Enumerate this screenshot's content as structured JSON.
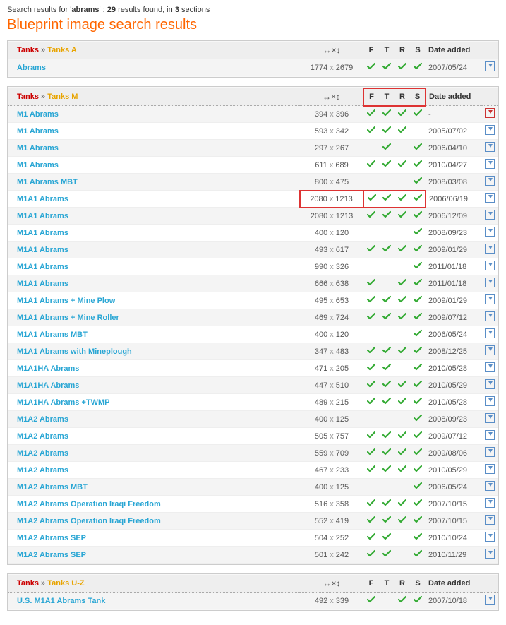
{
  "summary_prefix": "Search results for '",
  "query": "abrams",
  "summary_mid": "' : ",
  "result_count": "29",
  "summary_mid2": " results found, in ",
  "section_count": "3",
  "summary_suffix": " sections",
  "page_title": "Blueprint image search results",
  "col_labels": {
    "F": "F",
    "T": "T",
    "R": "R",
    "S": "S",
    "date": "Date added"
  },
  "dim_glyph": "↔×↕",
  "sections": [
    {
      "crumb_root": "Tanks",
      "crumb_leaf": "Tanks A",
      "rows": [
        {
          "name": "Abrams",
          "w": "1774",
          "h": "2679",
          "f": true,
          "t": true,
          "r": true,
          "s": true,
          "date": "2007/05/24",
          "dl": "blue"
        }
      ]
    },
    {
      "crumb_root": "Tanks",
      "crumb_leaf": "Tanks M",
      "highlight_ftrs_header": true,
      "rows": [
        {
          "name": "M1 Abrams",
          "w": "394",
          "h": "396",
          "f": true,
          "t": true,
          "r": true,
          "s": true,
          "date": "-",
          "dl": "red"
        },
        {
          "name": "M1 Abrams",
          "w": "593",
          "h": "342",
          "f": true,
          "t": true,
          "r": true,
          "s": false,
          "date": "2005/07/02",
          "dl": "blue"
        },
        {
          "name": "M1 Abrams",
          "w": "297",
          "h": "267",
          "f": false,
          "t": true,
          "r": false,
          "s": true,
          "date": "2006/04/10",
          "dl": "blue"
        },
        {
          "name": "M1 Abrams",
          "w": "611",
          "h": "689",
          "f": true,
          "t": true,
          "r": true,
          "s": true,
          "date": "2010/04/27",
          "dl": "blue"
        },
        {
          "name": "M1 Abrams MBT",
          "w": "800",
          "h": "475",
          "f": false,
          "t": false,
          "r": false,
          "s": true,
          "date": "2008/03/08",
          "dl": "blue"
        },
        {
          "name": "M1A1 Abrams",
          "w": "2080",
          "h": "1213",
          "f": true,
          "t": true,
          "r": true,
          "s": true,
          "date": "2006/06/19",
          "dl": "blue",
          "highlight": true
        },
        {
          "name": "M1A1 Abrams",
          "w": "2080",
          "h": "1213",
          "f": true,
          "t": true,
          "r": true,
          "s": true,
          "date": "2006/12/09",
          "dl": "blue"
        },
        {
          "name": "M1A1 Abrams",
          "w": "400",
          "h": "120",
          "f": false,
          "t": false,
          "r": false,
          "s": true,
          "date": "2008/09/23",
          "dl": "blue"
        },
        {
          "name": "M1A1 Abrams",
          "w": "493",
          "h": "617",
          "f": true,
          "t": true,
          "r": true,
          "s": true,
          "date": "2009/01/29",
          "dl": "blue"
        },
        {
          "name": "M1A1 Abrams",
          "w": "990",
          "h": "326",
          "f": false,
          "t": false,
          "r": false,
          "s": true,
          "date": "2011/01/18",
          "dl": "blue"
        },
        {
          "name": "M1A1 Abrams",
          "w": "666",
          "h": "638",
          "f": true,
          "t": false,
          "r": true,
          "s": true,
          "date": "2011/01/18",
          "dl": "blue"
        },
        {
          "name": "M1A1 Abrams + Mine Plow",
          "w": "495",
          "h": "653",
          "f": true,
          "t": true,
          "r": true,
          "s": true,
          "date": "2009/01/29",
          "dl": "blue"
        },
        {
          "name": "M1A1 Abrams + Mine Roller",
          "w": "469",
          "h": "724",
          "f": true,
          "t": true,
          "r": true,
          "s": true,
          "date": "2009/07/12",
          "dl": "blue"
        },
        {
          "name": "M1A1 Abrams MBT",
          "w": "400",
          "h": "120",
          "f": false,
          "t": false,
          "r": false,
          "s": true,
          "date": "2006/05/24",
          "dl": "blue"
        },
        {
          "name": "M1A1 Abrams with Mineplough",
          "w": "347",
          "h": "483",
          "f": true,
          "t": true,
          "r": true,
          "s": true,
          "date": "2008/12/25",
          "dl": "blue"
        },
        {
          "name": "M1A1HA Abrams",
          "w": "471",
          "h": "205",
          "f": true,
          "t": true,
          "r": false,
          "s": true,
          "date": "2010/05/28",
          "dl": "blue"
        },
        {
          "name": "M1A1HA Abrams",
          "w": "447",
          "h": "510",
          "f": true,
          "t": true,
          "r": true,
          "s": true,
          "date": "2010/05/29",
          "dl": "blue"
        },
        {
          "name": "M1A1HA Abrams +TWMP",
          "w": "489",
          "h": "215",
          "f": true,
          "t": true,
          "r": true,
          "s": true,
          "date": "2010/05/28",
          "dl": "blue"
        },
        {
          "name": "M1A2 Abrams",
          "w": "400",
          "h": "125",
          "f": false,
          "t": false,
          "r": false,
          "s": true,
          "date": "2008/09/23",
          "dl": "blue"
        },
        {
          "name": "M1A2 Abrams",
          "w": "505",
          "h": "757",
          "f": true,
          "t": true,
          "r": true,
          "s": true,
          "date": "2009/07/12",
          "dl": "blue"
        },
        {
          "name": "M1A2 Abrams",
          "w": "559",
          "h": "709",
          "f": true,
          "t": true,
          "r": true,
          "s": true,
          "date": "2009/08/06",
          "dl": "blue"
        },
        {
          "name": "M1A2 Abrams",
          "w": "467",
          "h": "233",
          "f": true,
          "t": true,
          "r": true,
          "s": true,
          "date": "2010/05/29",
          "dl": "blue"
        },
        {
          "name": "M1A2 Abrams MBT",
          "w": "400",
          "h": "125",
          "f": false,
          "t": false,
          "r": false,
          "s": true,
          "date": "2006/05/24",
          "dl": "blue"
        },
        {
          "name": "M1A2 Abrams Operation Iraqi Freedom",
          "w": "516",
          "h": "358",
          "f": true,
          "t": true,
          "r": true,
          "s": true,
          "date": "2007/10/15",
          "dl": "blue"
        },
        {
          "name": "M1A2 Abrams Operation Iraqi Freedom",
          "w": "552",
          "h": "419",
          "f": true,
          "t": true,
          "r": true,
          "s": true,
          "date": "2007/10/15",
          "dl": "blue"
        },
        {
          "name": "M1A2 Abrams SEP",
          "w": "504",
          "h": "252",
          "f": true,
          "t": true,
          "r": false,
          "s": true,
          "date": "2010/10/24",
          "dl": "blue"
        },
        {
          "name": "M1A2 Abrams SEP",
          "w": "501",
          "h": "242",
          "f": true,
          "t": true,
          "r": false,
          "s": true,
          "date": "2010/11/29",
          "dl": "blue"
        }
      ]
    },
    {
      "crumb_root": "Tanks",
      "crumb_leaf": "Tanks U-Z",
      "rows": [
        {
          "name": "U.S. M1A1 Abrams Tank",
          "w": "492",
          "h": "339",
          "f": true,
          "t": false,
          "r": true,
          "s": true,
          "date": "2007/10/18",
          "dl": "blue"
        }
      ]
    }
  ]
}
